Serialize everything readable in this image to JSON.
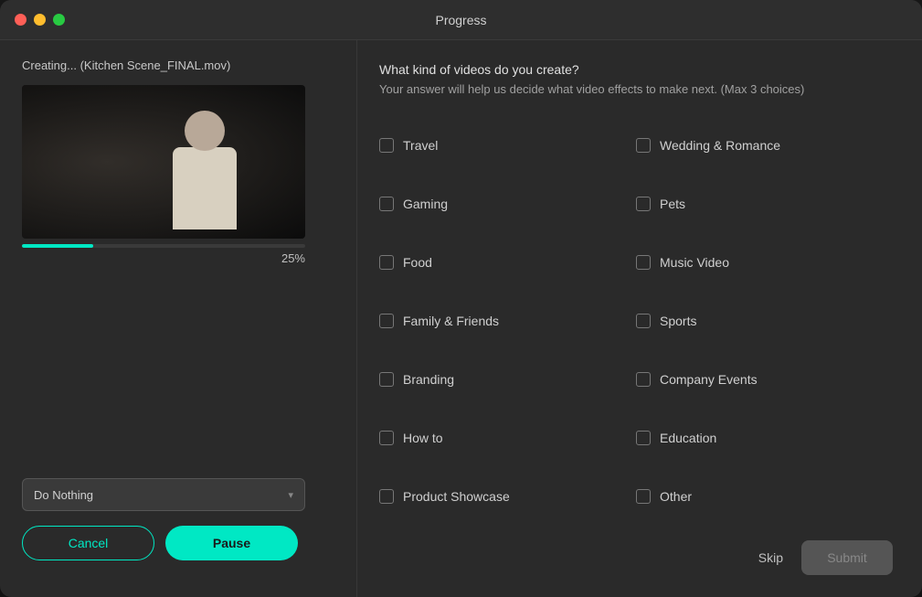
{
  "window": {
    "title": "Progress",
    "traffic_lights": {
      "red": "red",
      "yellow": "yellow",
      "green": "green"
    }
  },
  "left_panel": {
    "creating_label": "Creating... (Kitchen Scene_FINAL.mov)",
    "progress_percent": "25%",
    "dropdown": {
      "value": "Do Nothing",
      "chevron": "▾"
    },
    "buttons": {
      "cancel": "Cancel",
      "pause": "Pause"
    }
  },
  "right_panel": {
    "question_title": "What kind of videos do you create?",
    "question_subtitle": "Your answer will help us decide what video effects to make next.  (Max 3 choices)",
    "checkboxes": [
      {
        "id": "travel",
        "label": "Travel",
        "checked": false
      },
      {
        "id": "wedding",
        "label": "Wedding & Romance",
        "checked": false
      },
      {
        "id": "gaming",
        "label": "Gaming",
        "checked": false
      },
      {
        "id": "pets",
        "label": "Pets",
        "checked": false
      },
      {
        "id": "food",
        "label": "Food",
        "checked": false
      },
      {
        "id": "music-video",
        "label": "Music Video",
        "checked": false
      },
      {
        "id": "family-friends",
        "label": "Family & Friends",
        "checked": false
      },
      {
        "id": "sports",
        "label": "Sports",
        "checked": false
      },
      {
        "id": "branding",
        "label": "Branding",
        "checked": false
      },
      {
        "id": "company-events",
        "label": "Company Events",
        "checked": false
      },
      {
        "id": "how-to",
        "label": "How to",
        "checked": false
      },
      {
        "id": "education",
        "label": "Education",
        "checked": false
      },
      {
        "id": "product-showcase",
        "label": "Product Showcase",
        "checked": false
      },
      {
        "id": "other",
        "label": "Other",
        "checked": false
      }
    ],
    "actions": {
      "skip": "Skip",
      "submit": "Submit"
    }
  }
}
